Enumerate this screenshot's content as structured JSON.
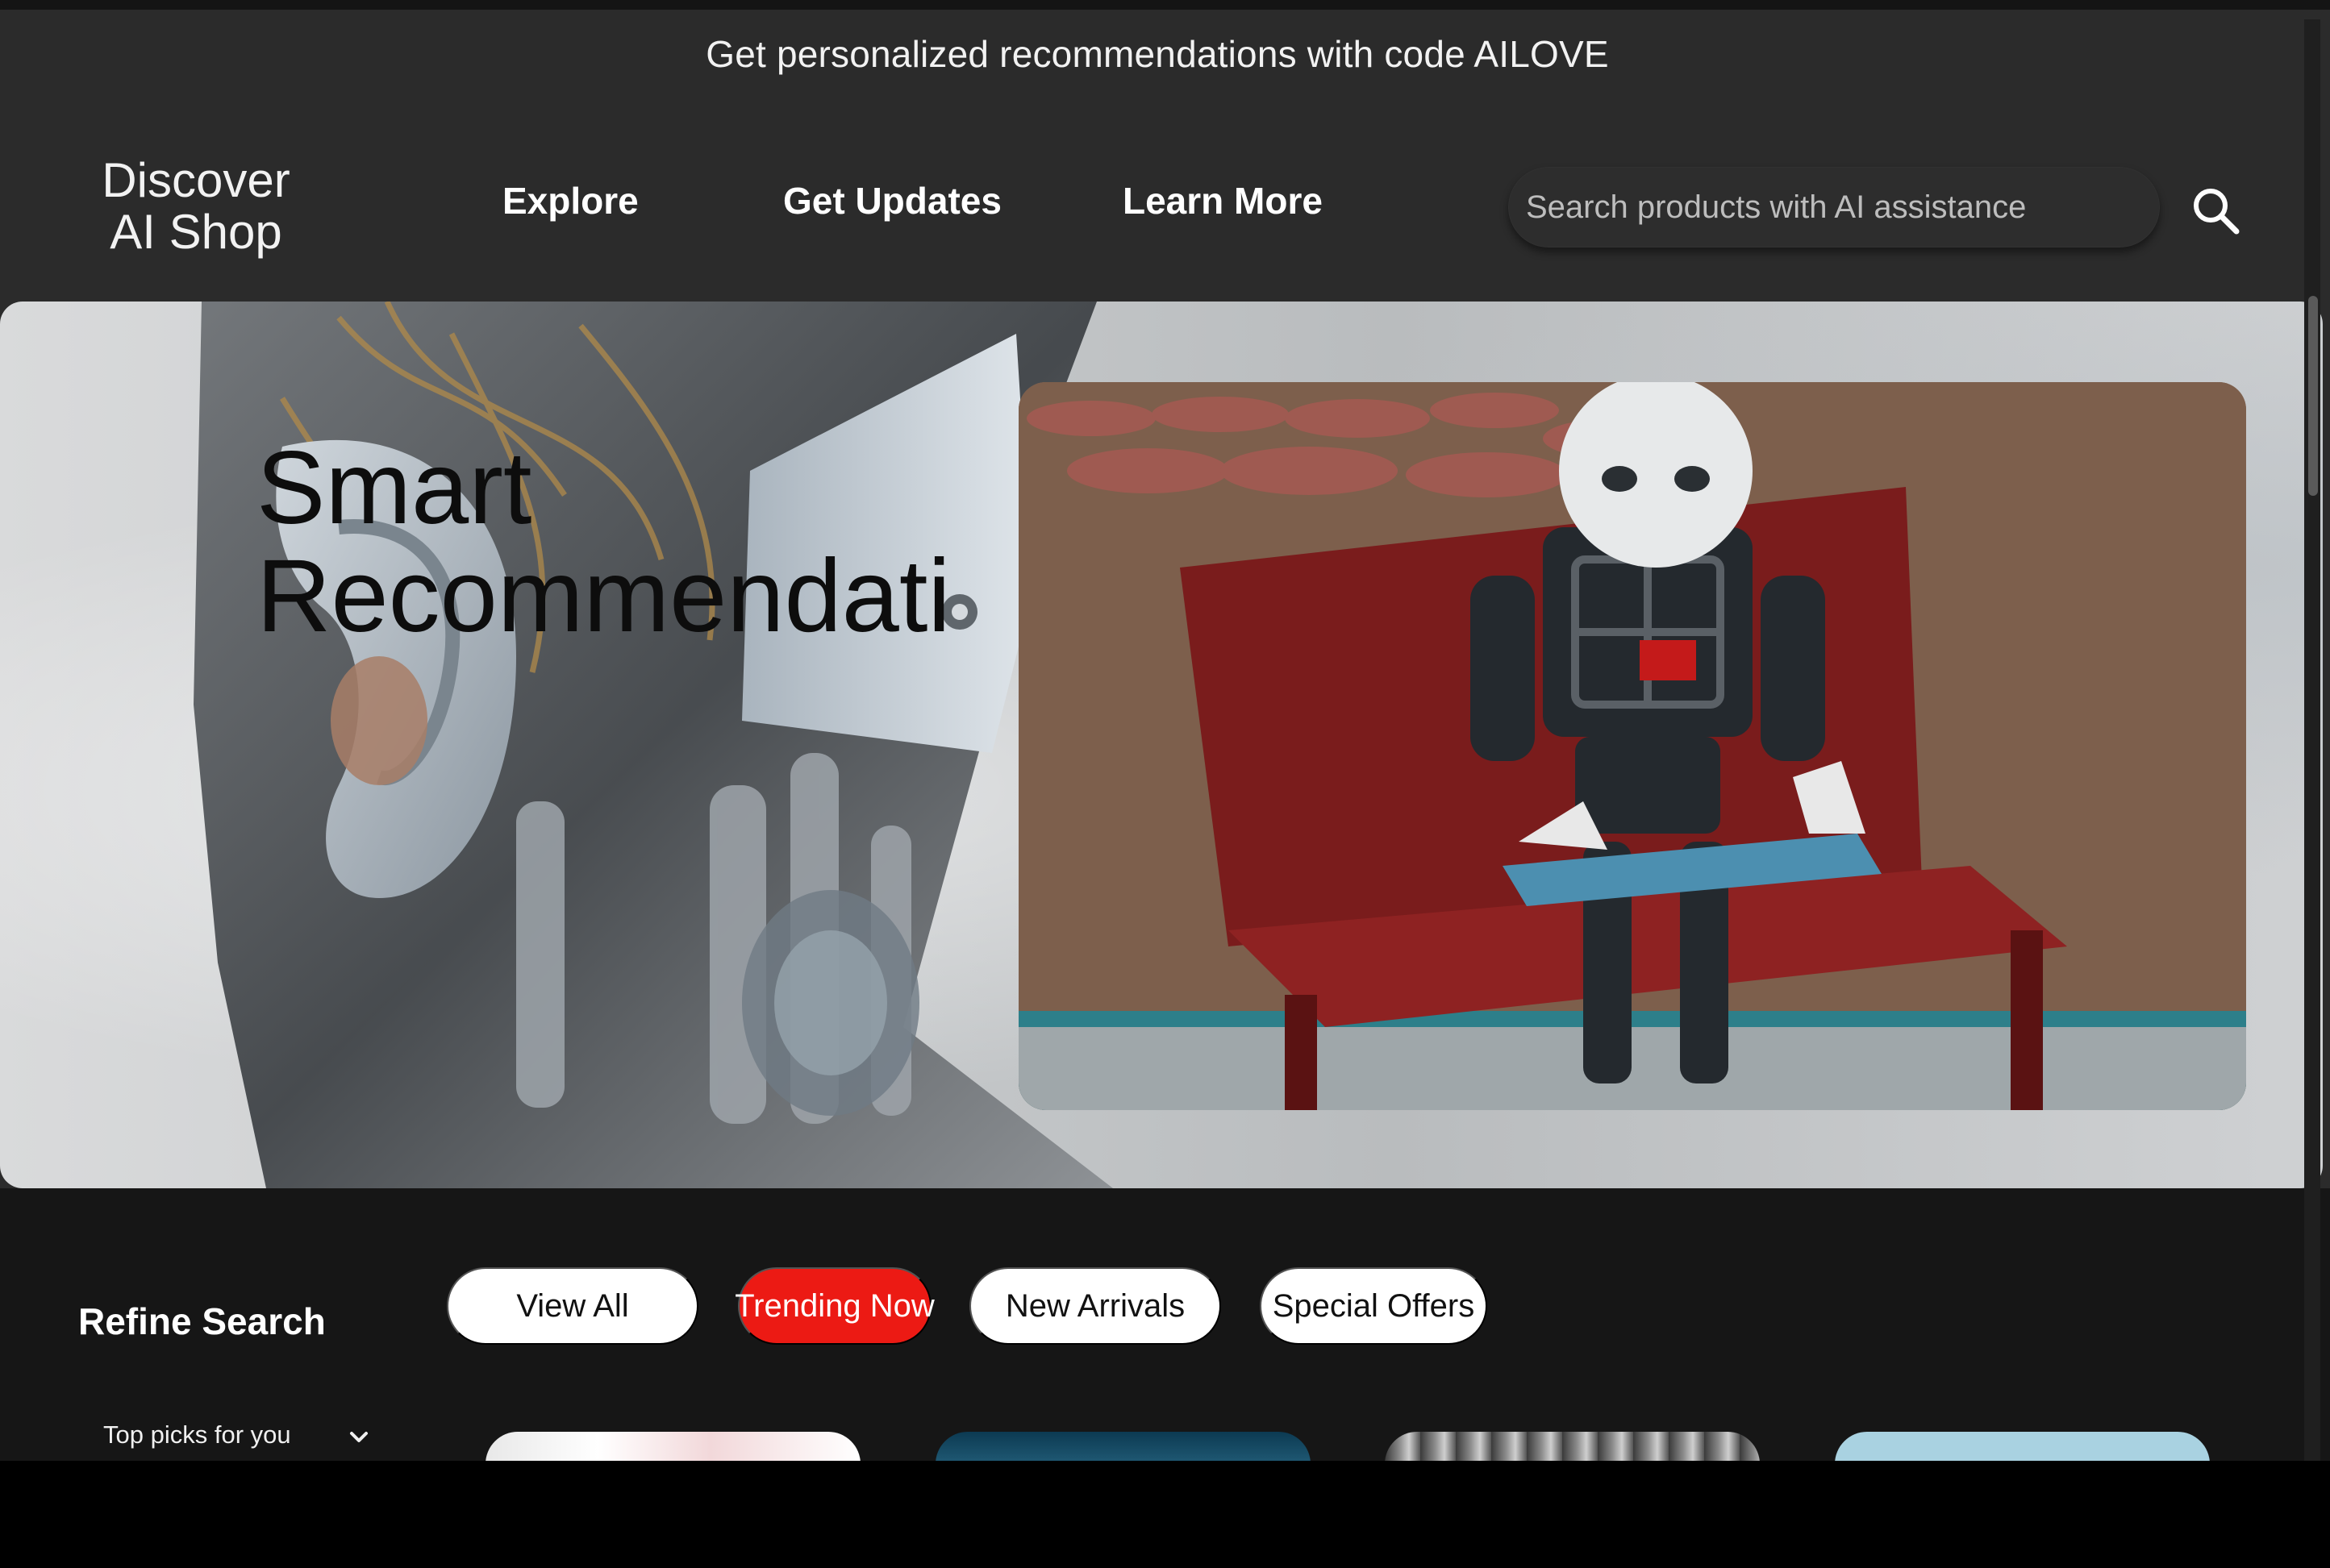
{
  "promo": {
    "text": "Get personalized recommendations with code AILOVE"
  },
  "header": {
    "logo_line1": "Discover",
    "logo_line2": "AI Shop",
    "nav": {
      "explore": "Explore",
      "updates": "Get Updates",
      "learn": "Learn More"
    },
    "search": {
      "placeholder": "Search products with AI assistance",
      "icon": "search-icon"
    }
  },
  "hero": {
    "title_line1": "Smart",
    "title_line2": "Recommendati"
  },
  "filters": {
    "title": "Refine Search",
    "pills": {
      "all": "View All",
      "trending": "Trending Now",
      "new": "New Arrivals",
      "offers": "Special Offers"
    },
    "active_pill": "Trending Now",
    "sort": {
      "selected": "Top picks for you",
      "icon": "chevron-down-icon"
    }
  },
  "colors": {
    "page_background": "#2b2b2b",
    "lower_background": "#161616",
    "active_pill": "#ec1a14",
    "pill": "#ffffff"
  }
}
